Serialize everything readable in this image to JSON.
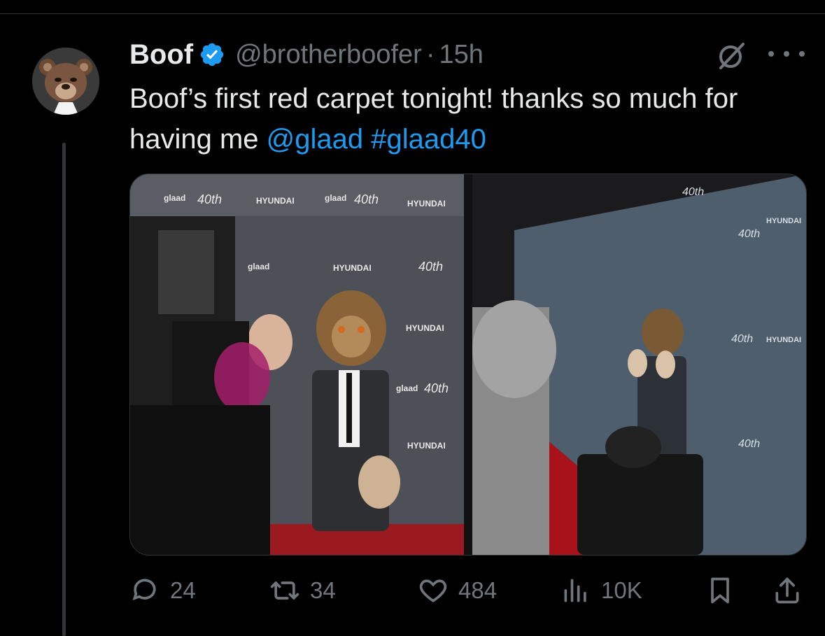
{
  "tweet": {
    "author": {
      "name": "Boof",
      "handle": "@brotherboofer",
      "verified": true
    },
    "separator": "·",
    "time": "15h",
    "text_parts": [
      {
        "text": "Boof’s first red carpet tonight! thanks so much for having me ",
        "link": false
      },
      {
        "text": "@glaad",
        "link": true
      },
      {
        "text": " ",
        "link": false
      },
      {
        "text": "#glaad40",
        "link": true
      }
    ],
    "media": [
      {
        "icon": "photo-red-carpet-photographer",
        "wall_texts": [
          "glaad",
          "40th",
          "HYUNDAI",
          "glaad",
          "40th",
          "HYUNDAI",
          "HYUNDAI",
          "glaad",
          "40th",
          "HYUNDAI",
          "glaad",
          "40th",
          "HYUNDAI"
        ]
      },
      {
        "icon": "photo-red-carpet-cameraman",
        "wall_texts": [
          "40th",
          "HYUNDAI",
          "40th",
          "40th",
          "HYUNDAI",
          "40th"
        ]
      }
    ],
    "stats": {
      "replies": "24",
      "reposts": "34",
      "likes": "484",
      "views": "10K"
    }
  },
  "colors": {
    "background": "#000000",
    "text": "#e7e9ea",
    "muted": "#71767b",
    "link": "#1d9bf0",
    "verified": "#1d9bf0"
  }
}
